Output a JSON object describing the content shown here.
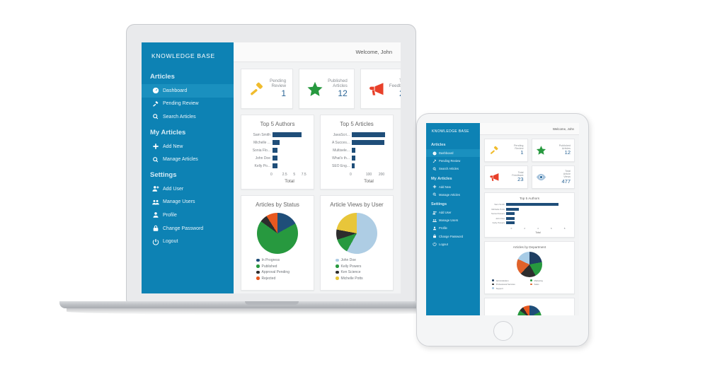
{
  "brand": "KNOWLEDGE BASE",
  "topbar": {
    "welcome": "Welcome, John"
  },
  "colors": {
    "sidebar": "#0d82b4",
    "sidebar_active": "#1a90bf",
    "bar": "#1f4e79",
    "stat_number": "#2a6496",
    "gavel": "#f0bc2e",
    "star": "#27993f",
    "megaphone": "#e8402a",
    "eye": "#a8c4dd"
  },
  "sidebar": {
    "sections": [
      {
        "title": "Articles",
        "items": [
          {
            "label": "Dashboard",
            "icon": "dashboard-icon",
            "active": true
          },
          {
            "label": "Pending Review",
            "icon": "gavel-icon",
            "active": false
          },
          {
            "label": "Search Articles",
            "icon": "search-icon",
            "active": false
          }
        ]
      },
      {
        "title": "My Articles",
        "items": [
          {
            "label": "Add New",
            "icon": "plus-icon",
            "active": false
          },
          {
            "label": "Manage Articles",
            "icon": "search-icon",
            "active": false
          }
        ]
      },
      {
        "title": "Settings",
        "items": [
          {
            "label": "Add User",
            "icon": "user-plus-icon",
            "active": false
          },
          {
            "label": "Manage Users",
            "icon": "users-icon",
            "active": false
          },
          {
            "label": "Profile",
            "icon": "user-icon",
            "active": false
          },
          {
            "label": "Change Password",
            "icon": "lock-icon",
            "active": false
          },
          {
            "label": "Logout",
            "icon": "power-icon",
            "active": false
          }
        ]
      }
    ]
  },
  "stats": [
    {
      "label_line1": "Pending",
      "label_line2": "Review",
      "label_line3": "",
      "value": "1",
      "icon": "gavel-icon",
      "color": "#f0bc2e"
    },
    {
      "label_line1": "Published",
      "label_line2": "Articles",
      "label_line3": "",
      "value": "12",
      "icon": "star-icon",
      "color": "#27993f"
    },
    {
      "label_line1": "Total",
      "label_line2": "Feedback",
      "label_line3": "",
      "value": "23",
      "icon": "megaphone-icon",
      "color": "#e8402a"
    },
    {
      "label_line1": "Total",
      "label_line2": "Article",
      "label_line3": "Views",
      "value": "477",
      "icon": "eye-icon",
      "color": "#a8c4dd"
    }
  ],
  "chart_data": [
    {
      "type": "bar",
      "id": "top-5-authors",
      "title": "Top 5 Authors",
      "orientation": "horizontal",
      "categories": [
        "Sam Smith",
        "Michelle ...",
        "Sonia Flo...",
        "John Doe",
        "Kelly Po..."
      ],
      "categories_full": [
        "Sam Smith",
        "Michelle Potts",
        "Sonia Flowers",
        "John Doe",
        "Kelly Powers"
      ],
      "values": [
        6,
        1.5,
        1,
        1,
        1
      ],
      "xlabel": "Total",
      "ylabel": "",
      "xticks": [
        "0",
        "2.5",
        "5",
        "7.5"
      ],
      "xlim": [
        0,
        7.5
      ],
      "grid": false,
      "color": "#1f4e79"
    },
    {
      "type": "bar",
      "id": "top-5-articles",
      "title": "Top 5 Articles",
      "orientation": "horizontal",
      "categories": [
        "JavaScri...",
        "A Succes...",
        "Multisele...",
        "What's th...",
        "SEO Eng..."
      ],
      "values": [
        185,
        180,
        20,
        20,
        15
      ],
      "xlabel": "Total",
      "ylabel": "",
      "xticks": [
        "0",
        "100",
        "200"
      ],
      "xlim": [
        0,
        200
      ],
      "grid": false,
      "color": "#1f4e79"
    },
    {
      "type": "pie",
      "id": "articles-by-status",
      "title": "Articles by Status",
      "labels": [
        "In Progress",
        "Published",
        "Approval Pending",
        "Rejected"
      ],
      "values": [
        17,
        68,
        6,
        9
      ],
      "colors": [
        "#1f4e79",
        "#27993f",
        "#2d2d2d",
        "#e8581f"
      ],
      "legend_position": "bottom"
    },
    {
      "type": "pie",
      "id": "article-views-by-user",
      "title": "Article Views by User",
      "labels": [
        "John Doe",
        "Kelly Powers",
        "Ken Science",
        "Michelle Potts"
      ],
      "values": [
        58,
        12,
        8,
        22
      ],
      "colors": [
        "#aecde4",
        "#27993f",
        "#2d2d2d",
        "#e8c63a"
      ],
      "legend_position": "bottom"
    },
    {
      "type": "pie",
      "id": "articles-by-department",
      "title": "Articles by Department",
      "labels": [
        "Administration",
        "Marketing",
        "Professional Services",
        "Sales",
        "Support"
      ],
      "values": [
        22,
        20,
        20,
        20,
        18
      ],
      "colors": [
        "#1f3f63",
        "#27993f",
        "#2d2d2d",
        "#e0622a",
        "#a8cce6"
      ],
      "legend_position": "bottom"
    }
  ],
  "tablet": {
    "status_card_title": "Articles by Status"
  }
}
